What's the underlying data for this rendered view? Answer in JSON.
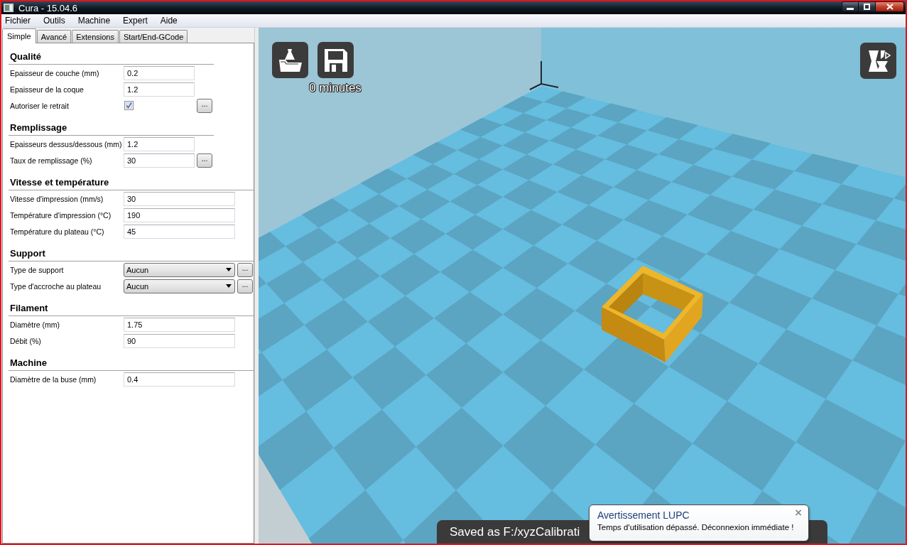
{
  "window": {
    "title": "Cura - 15.04.6"
  },
  "menu": [
    {
      "label": "Fichier"
    },
    {
      "label": "Outils"
    },
    {
      "label": "Machine"
    },
    {
      "label": "Expert"
    },
    {
      "label": "Aide"
    }
  ],
  "tabs": [
    {
      "label": "Simple",
      "selected": true
    },
    {
      "label": "Avancé",
      "selected": false
    },
    {
      "label": "Extensions",
      "selected": false
    },
    {
      "label": "Start/End-GCode",
      "selected": false
    }
  ],
  "settings": [
    {
      "title": "Qualité",
      "rows": [
        {
          "kind": "text",
          "label": "Epaisseur de couche (mm)",
          "value": "0.2"
        },
        {
          "kind": "text",
          "label": "Epaisseur de la coque",
          "value": "1.2"
        },
        {
          "kind": "checkbox",
          "label": "Autoriser le retrait",
          "checked": true,
          "button": "..."
        }
      ]
    },
    {
      "title": "Remplissage",
      "rows": [
        {
          "kind": "text",
          "label": "Epaisseurs dessus/dessous (mm)",
          "value": "1.2"
        },
        {
          "kind": "text",
          "label": "Taux de remplissage (%)",
          "value": "30",
          "button": "..."
        }
      ]
    },
    {
      "title": "Vitesse et température",
      "rows": [
        {
          "kind": "text",
          "label": "Vitesse d'impression (mm/s)",
          "value": "30"
        },
        {
          "kind": "text",
          "label": "Température d'impression (°C)",
          "value": "190"
        },
        {
          "kind": "text",
          "label": "Température du plateau (°C)",
          "value": "45"
        }
      ]
    },
    {
      "title": "Support",
      "rows": [
        {
          "kind": "select",
          "label": "Type de support",
          "value": "Aucun",
          "button": "..."
        },
        {
          "kind": "select",
          "label": "Type d'accroche au plateau",
          "value": "Aucun",
          "button": "..."
        }
      ]
    },
    {
      "title": "Filament",
      "rows": [
        {
          "kind": "text",
          "label": "Diamètre (mm)",
          "value": "1.75"
        },
        {
          "kind": "text",
          "label": "Débit (%)",
          "value": "90"
        }
      ]
    },
    {
      "title": "Machine",
      "rows": [
        {
          "kind": "text",
          "label": "Diamètre de la buse (mm)",
          "value": "0.4"
        }
      ]
    }
  ],
  "viewport": {
    "print_time": "0 minutes",
    "status_message": "Saved as F:/xyzCalibrati"
  },
  "notification": {
    "title": "Avertissement LUPC",
    "message": "Temps d'utilisation dépassé. Déconnexion immédiate !",
    "close": "×"
  }
}
